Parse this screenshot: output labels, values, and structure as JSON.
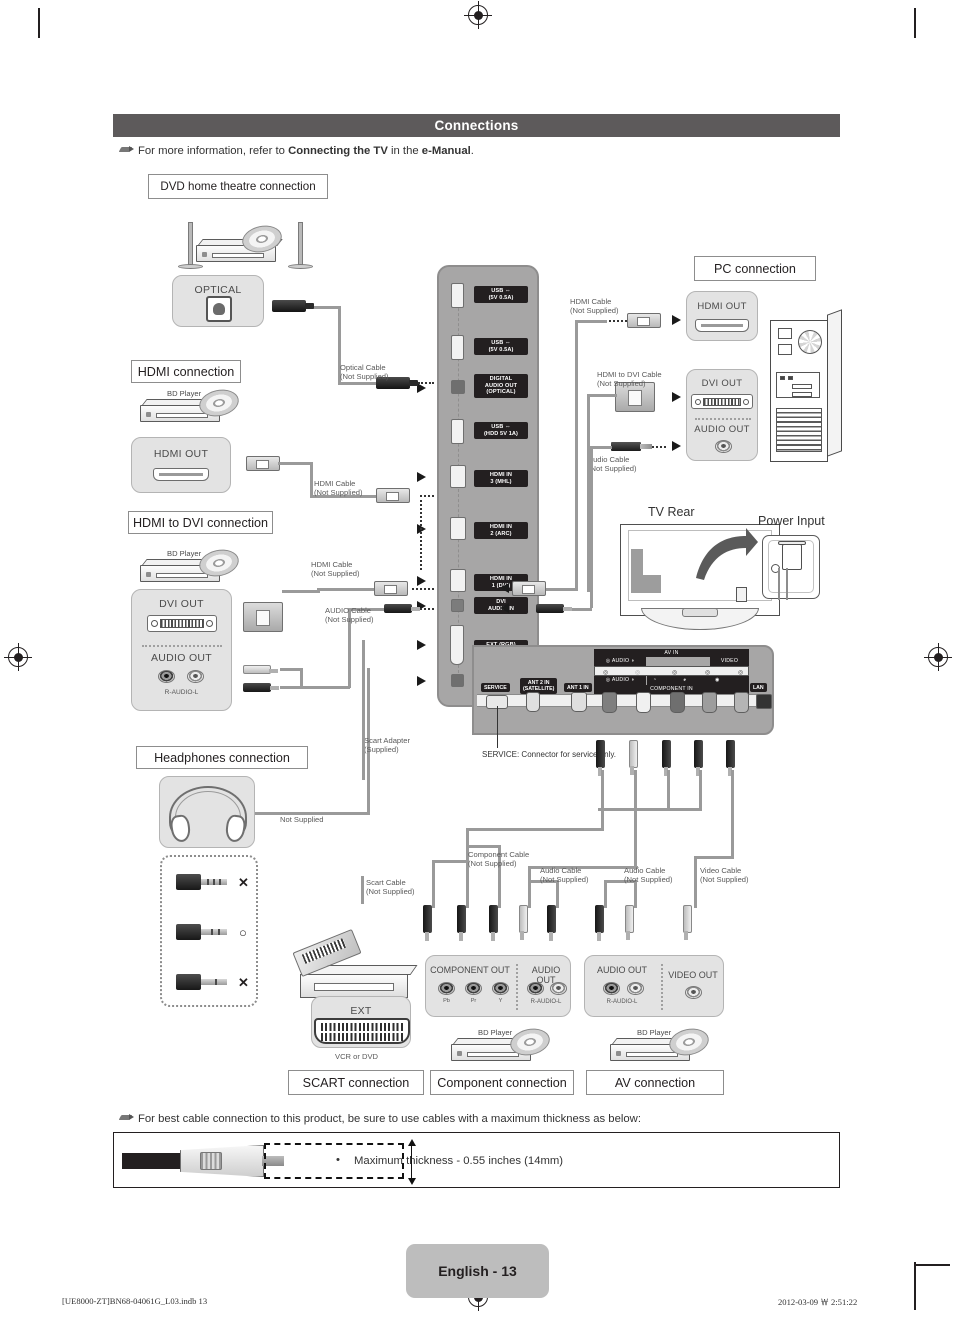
{
  "header": {
    "band_title": "Connections",
    "note_prefix": "For more information, refer to ",
    "note_bold1": "Connecting the TV",
    "note_mid": " in the ",
    "note_bold2": "e-Manual",
    "note_suffix": "."
  },
  "section_titles": {
    "dvd_home_theatre": "DVD home theatre connection",
    "hdmi": "HDMI connection",
    "hdmi_to_dvi": "HDMI to DVI connection",
    "headphones": "Headphones connection",
    "pc": "PC connection",
    "scart": "SCART connection",
    "component": "Component connection",
    "av": "AV connection"
  },
  "device_panels": {
    "optical": {
      "label": "OPTICAL"
    },
    "hdmi_out": {
      "label": "HDMI OUT"
    },
    "dvi_out_left": {
      "label": "DVI OUT",
      "audio_label": "AUDIO OUT",
      "audio_sub": "R-AUDIO-L"
    },
    "pc_hdmi_out": {
      "label": "HDMI OUT"
    },
    "pc_dvi_out": {
      "label": "DVI OUT",
      "audio_label": "AUDIO OUT"
    },
    "ext": {
      "label": "EXT",
      "caption": "VCR or DVD"
    },
    "component_out": {
      "label": "COMPONENT OUT",
      "jacks": [
        "Pb",
        "Pr",
        "Y"
      ],
      "audio_label": "AUDIO OUT",
      "audio_sub": "R-AUDIO-L"
    },
    "av_out": {
      "audio_label": "AUDIO OUT",
      "audio_sub": "R-AUDIO-L",
      "video_label": "VIDEO OUT"
    }
  },
  "tv_side_ports": [
    {
      "label": "USB ⛛\n(5V 0.5A)",
      "line1": "USB",
      "line2": "(5V 0.5A)",
      "arrow": false
    },
    {
      "label": "USB",
      "line1": "USB",
      "line2": "(5V 0.5A)",
      "arrow": false
    },
    {
      "label": "DIGITAL AUDIO OUT (OPTICAL)",
      "line1": "DIGITAL",
      "line2": "AUDIO OUT",
      "line3": "(OPTICAL)",
      "arrow": true
    },
    {
      "label": "USB (HDD 5V 1A)",
      "line1": "USB",
      "line2": "(HDD 5V 1A)",
      "arrow": false
    },
    {
      "label": "HDMI IN 3 (MHL)",
      "line1": "HDMI IN",
      "line2": "3 (MHL)",
      "arrow": true
    },
    {
      "label": "HDMI IN 2 (ARC)",
      "line1": "HDMI IN",
      "line2": "2 (ARC)",
      "arrow": true
    },
    {
      "label": "HDMI IN 1 (DVI)",
      "line1": "HDMI IN",
      "line2": "1 (DVI)",
      "arrow": true
    },
    {
      "label": "DVI AUDIO IN",
      "line1": "DVI",
      "line2": "AUDIO IN",
      "arrow": true
    },
    {
      "label": "EXT (RGB)",
      "line1": "EXT (RGB)",
      "arrow": true
    },
    {
      "label": "Headphone",
      "line1": "⌒",
      "arrow": true
    }
  ],
  "tv_bottom_ports": {
    "service": "SERVICE",
    "ant2": "ANT 2 IN (SATELLITE)",
    "ant1": "ANT 1 IN",
    "lan": "LAN",
    "av_in": "AV IN",
    "component_in": "COMPONENT IN",
    "audio_left": "AUDIO",
    "audio_right": "AUDIO",
    "video": "VIDEO",
    "service_note": "SERVICE: Connector for service only."
  },
  "cable_labels": {
    "optical_cable": "Optical Cable\n(Not Supplied)",
    "optical_cable_l1": "Optical Cable",
    "optical_cable_l2": "(Not Supplied)",
    "hdmi_cable_l1": "HDMI Cable",
    "hdmi_cable_l2": "(Not Supplied)",
    "hdmi_cable2_l1": "HDMI Cable",
    "hdmi_cable2_l2": "(Not Supplied)",
    "audio_cable_l1": "AUDIO Cable",
    "audio_cable_l2": "(Not Supplied)",
    "pc_hdmi_cable_l1": "HDMI Cable",
    "pc_hdmi_cable_l2": "(Not Supplied)",
    "pc_hdmi_dvi_cable_l1": "HDMI to DVI Cable",
    "pc_hdmi_dvi_cable_l2": "(Not Supplied)",
    "pc_audio_cable_l1": "Audio Cable",
    "pc_audio_cable_l2": "(Not Supplied)",
    "not_supplied": "Not Supplied",
    "scart_adapter_l1": "Scart Adapter",
    "scart_adapter_l2": "(Supplied)",
    "scart_cable_l1": "Scart Cable",
    "scart_cable_l2": "(Not Supplied)",
    "component_cable_l1": "Component Cable",
    "component_cable_l2": "(Not Supplied)",
    "audio_cable3_l1": "Audio Cable",
    "audio_cable3_l2": "(Not Supplied)",
    "audio_cable4_l1": "Audio Cable",
    "audio_cable4_l2": "(Not Supplied)",
    "video_cable_l1": "Video Cable",
    "video_cable_l2": "(Not Supplied)"
  },
  "device_captions": {
    "bd_player": "BD Player",
    "bd_player2": "BD Player",
    "bd_player3": "BD Player",
    "bd_player4": "BD Player",
    "tv_rear": "TV Rear",
    "power_input": "Power Input"
  },
  "bottom_note": {
    "text": "For best cable connection to this product, be sure to use cables with a maximum thickness as below:",
    "bullet": "Maximum thickness - 0.55 inches (14mm)"
  },
  "footer": {
    "page_tab": "English - 13",
    "file": "[UE8000-ZT]BN68-04061G_L03.indb   13",
    "timestamp": "2012-03-09   ￦ 2:51:22"
  },
  "colors": {
    "band": "#5d5a5b",
    "panel": "#e3e3e3",
    "tv_body": "#a7a6a6",
    "cable": "#9a9a9a",
    "text": "#231f20",
    "page_tab": "#bdbdbd"
  }
}
